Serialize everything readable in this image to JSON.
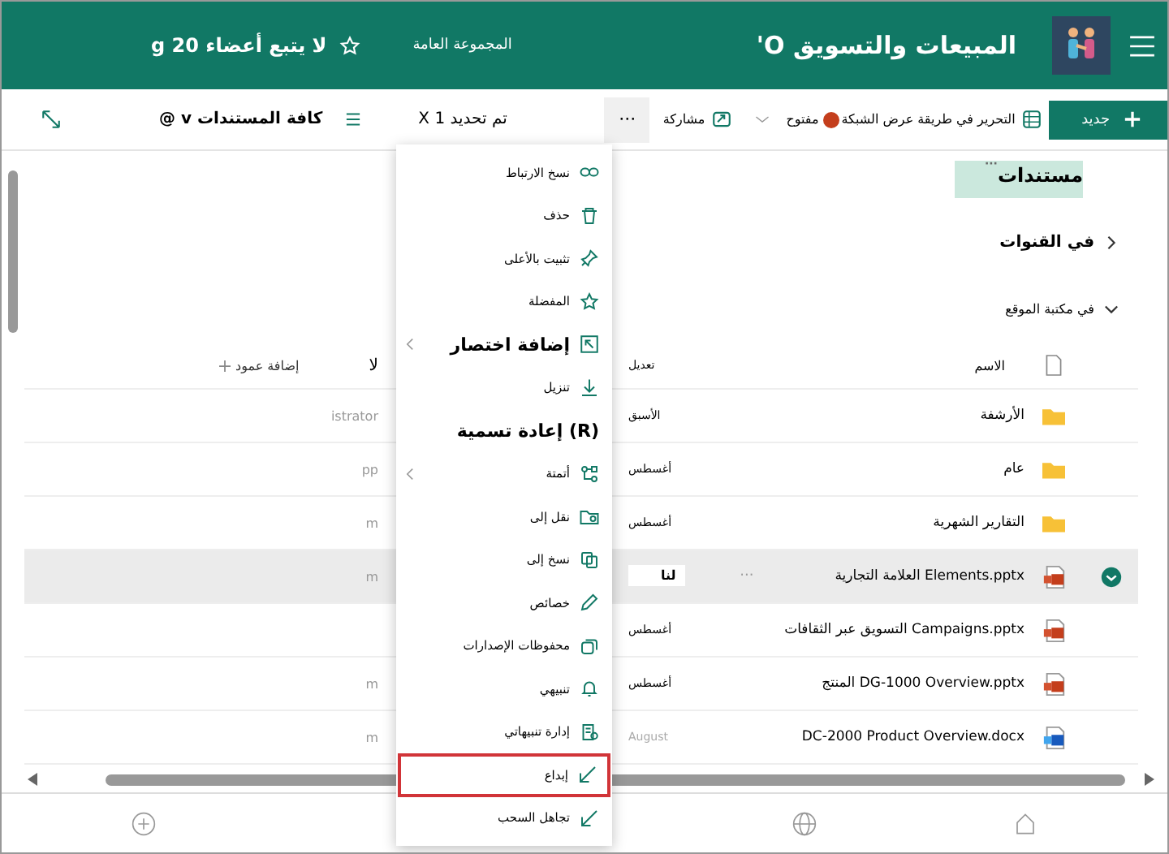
{
  "header": {
    "title": "المبيعات والتسويق O'",
    "group": "المجموعة العامة",
    "members": "لا يتبع أعضاء 20 g"
  },
  "toolbar": {
    "new": "جديد",
    "grid_edit": "التحرير في طريقة عرض الشبكة",
    "open": "مفتوح",
    "share": "مشاركة",
    "more": "···",
    "selection": "تم تحديد 1 X",
    "view": "كافة المستندات v @"
  },
  "library": {
    "title": "مستندات",
    "title_more": "···",
    "channels": "في القنوات",
    "site_library": "في مكتبة الموقع"
  },
  "table": {
    "columns": {
      "name": "الاسم",
      "modified": "تعديل",
      "column_3": "ﻻ",
      "add_column": "إضافة عمود"
    },
    "rows": [
      {
        "kind": "folder",
        "name": "الأرشفة",
        "modified": "الأسبق",
        "column_3": "istrator",
        "selected": false
      },
      {
        "kind": "folder",
        "name": "عام",
        "modified": "أغسطس",
        "column_3": "pp",
        "selected": false
      },
      {
        "kind": "folder",
        "name": "التقارير الشهرية",
        "modified": "أغسطس",
        "column_3": "m",
        "selected": false
      },
      {
        "kind": "pptx",
        "name": "Elements.pptx العلامة التجارية",
        "modified": "لنا",
        "column_3": "m",
        "more": "···",
        "selected": true
      },
      {
        "kind": "pptx",
        "name": "Campaigns.pptx التسويق عبر الثقافات",
        "modified": "أغسطس",
        "selected": false
      },
      {
        "kind": "pptx",
        "name": "DG-1000 Overview.pptx المنتج",
        "modified": "أغسطس",
        "column_3": "m",
        "selected": false
      },
      {
        "kind": "docx",
        "name": "DC-2000 Product Overview.docx",
        "modified": "August",
        "column_3": "m",
        "selected": false
      }
    ]
  },
  "menu": [
    {
      "kind": "link",
      "label": "نسخ الارتباط",
      "selected": false
    },
    {
      "kind": "delete",
      "label": "حذف",
      "selected": false
    },
    {
      "kind": "pin",
      "label": "تثبيت بالأعلى",
      "selected": false
    },
    {
      "kind": "star",
      "label": "المفضلة",
      "selected": false
    },
    {
      "kind": "shortcut",
      "label": "إضافة اختصار",
      "submenu": true,
      "large": true,
      "selected": false
    },
    {
      "kind": "download",
      "label": "تنزيل",
      "selected": false
    },
    {
      "kind": "none",
      "label": "(R) إعادة تسمية",
      "large": true,
      "selected": false
    },
    {
      "kind": "flow",
      "label": "أتمتة",
      "submenu": true,
      "selected": false
    },
    {
      "kind": "move",
      "label": "نقل إلى",
      "selected": false
    },
    {
      "kind": "copy",
      "label": "نسخ إلى",
      "selected": false
    },
    {
      "kind": "pencil",
      "label": "خصائص",
      "selected": false
    },
    {
      "kind": "versions",
      "label": "محفوظات الإصدارات",
      "selected": false
    },
    {
      "kind": "bell",
      "label": "تنبيهي",
      "selected": false
    },
    {
      "kind": "alerts",
      "label": "إدارة تنبيهاتي",
      "selected": false
    },
    {
      "kind": "arrow",
      "label": "إبداع",
      "selected": true
    },
    {
      "kind": "arrow",
      "label": "تجاهل السحب",
      "selected": false
    }
  ]
}
